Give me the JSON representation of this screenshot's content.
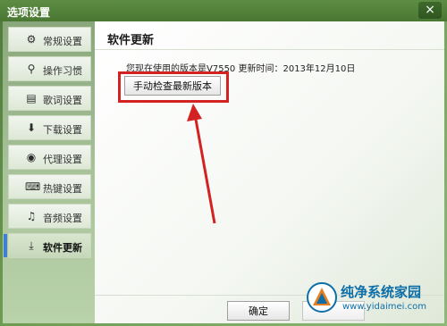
{
  "window": {
    "title": "选项设置",
    "close_glyph": "×"
  },
  "sidebar": {
    "items": [
      {
        "label": "常规设置",
        "icon": "gear-icon",
        "glyph": "⚙"
      },
      {
        "label": "操作习惯",
        "icon": "pin-icon",
        "glyph": "⚲"
      },
      {
        "label": "歌词设置",
        "icon": "lyrics-icon",
        "glyph": "▤"
      },
      {
        "label": "下载设置",
        "icon": "download-icon",
        "glyph": "⬇"
      },
      {
        "label": "代理设置",
        "icon": "globe-icon",
        "glyph": "◉"
      },
      {
        "label": "热键设置",
        "icon": "keyboard-icon",
        "glyph": "⌨"
      },
      {
        "label": "音频设置",
        "icon": "equalizer-icon",
        "glyph": "♫"
      },
      {
        "label": "软件更新",
        "icon": "update-icon",
        "glyph": "⤓",
        "active": true
      }
    ]
  },
  "main": {
    "section_title": "软件更新",
    "info_text": "您现在使用的版本是V7550 更新时间：2013年12月10日",
    "check_button_label": "手动检查最新版本"
  },
  "footer": {
    "ok_label": "确定"
  },
  "watermark": {
    "title": "纯净系统家园",
    "url": "www.yidaimei.com"
  },
  "colors": {
    "highlight": "#d22222",
    "accent": "#3f7fd6"
  }
}
